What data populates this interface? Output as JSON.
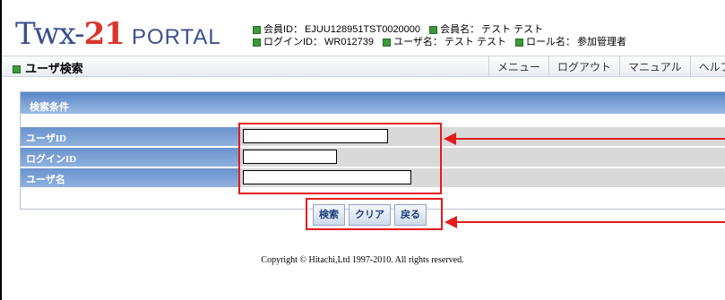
{
  "logo": {
    "twx": "Twx-",
    "num": "21",
    "portal": "PORTAL"
  },
  "info": {
    "member_id_label": "会員ID：",
    "member_id": "EJUU128951TST0020000",
    "member_name_label": "会員名：",
    "member_name": "テスト テスト",
    "login_id_label": "ログインID：",
    "login_id": "WR012739",
    "user_name_label": "ユーザ名：",
    "user_name": "テスト テスト",
    "role_label": "ロール名：",
    "role": "参加管理者"
  },
  "nav": {
    "page_title": "ユーザ検索",
    "links": [
      "メニュー",
      "ログアウト",
      "マニュアル",
      "ヘルプ"
    ]
  },
  "panel": {
    "title": "検索条件"
  },
  "form": {
    "fields": [
      {
        "label": "ユーザID",
        "value": ""
      },
      {
        "label": "ログインID",
        "value": ""
      },
      {
        "label": "ユーザ名",
        "value": ""
      }
    ]
  },
  "buttons": {
    "search": "検索",
    "clear": "クリア",
    "back": "戻る"
  },
  "footer": "Copyright © Hitachi,Ltd 1997-2010. All rights reserved.",
  "colors": {
    "accent": "#e41b1b",
    "header_blue": "#5a86c7",
    "logo_blue": "#3a4f8f",
    "logo_red": "#d9352b"
  }
}
